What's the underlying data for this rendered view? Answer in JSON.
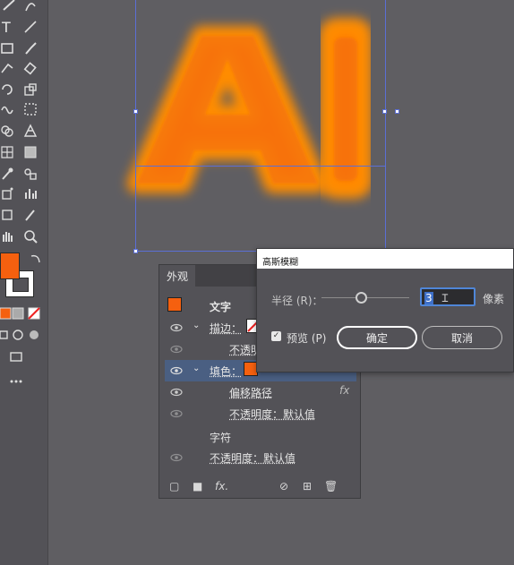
{
  "appearance_panel": {
    "tab_label": "外观",
    "object_label": "文字",
    "stroke_label": "描边：",
    "opacity_label": "不透明",
    "fill_label": "填色：",
    "offset_path_label": "偏移路径",
    "fx_label": "fx",
    "opacity_default_label": "不透明度：默认值",
    "characters_label": "字符",
    "opacity_default_label_2": "不透明度：默认值",
    "fill_color": "#f5600f"
  },
  "gaussian_blur_dialog": {
    "title": "高斯模糊",
    "radius_label": "半径 (R)：",
    "radius_value": "3",
    "unit_label": "像素",
    "preview_checked": true,
    "preview_label": "预览 (P)",
    "ok_label": "确定",
    "cancel_label": "取消"
  },
  "artwork": {
    "text": "AI",
    "color": "#ff8a00",
    "shadow_color": "#f06a10"
  },
  "toolbar": {
    "fill_swatch_color": "#f5600f",
    "stroke_swatch_color": "#ffffff"
  }
}
